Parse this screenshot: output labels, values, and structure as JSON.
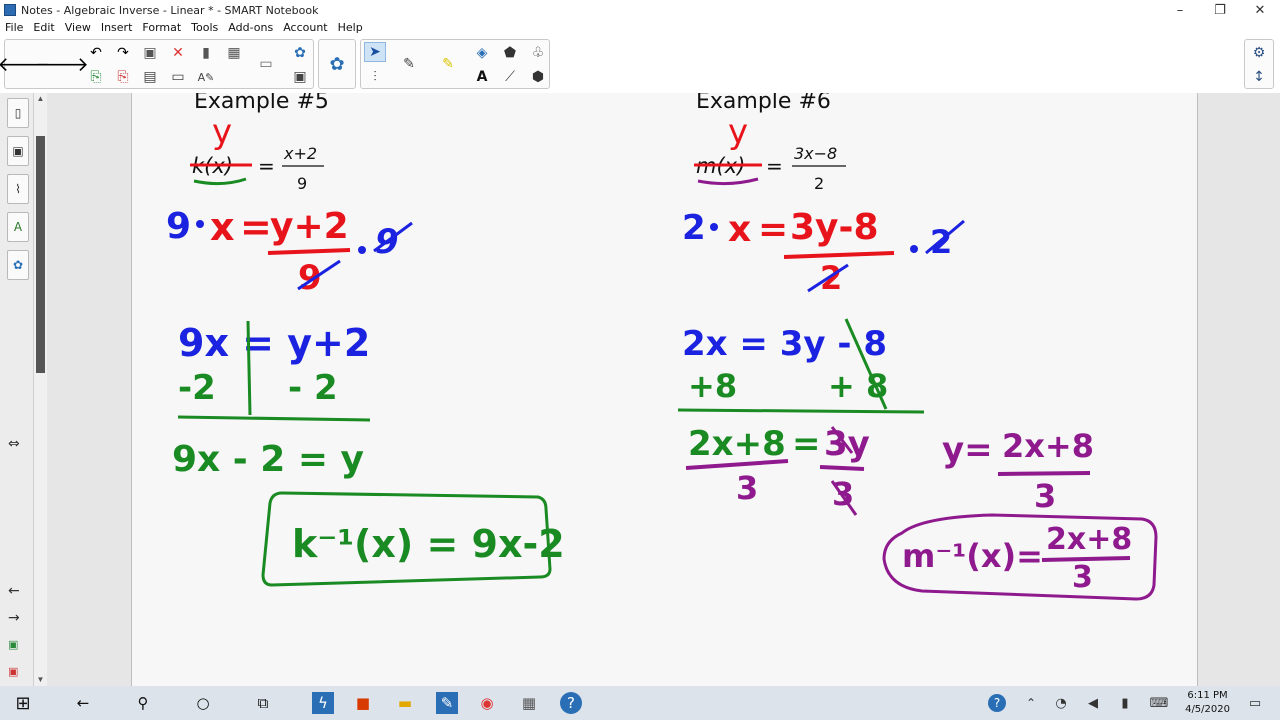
{
  "window": {
    "title": "Notes - Algebraic Inverse - Linear * - SMART Notebook",
    "controls": {
      "minimize": "–",
      "restore": "❐",
      "close": "✕"
    }
  },
  "menu": [
    "File",
    "Edit",
    "View",
    "Insert",
    "Format",
    "Tools",
    "Add-ons",
    "Account",
    "Help"
  ],
  "toolbar": {
    "icons": [
      "back-arrow-icon",
      "forward-arrow-icon",
      "undo-icon",
      "redo-icon",
      "add-page-icon",
      "delete-icon",
      "screen-shade-icon",
      "table-icon",
      "addons-icon",
      "save-icon",
      "paste-icon",
      "display-icon",
      "full-screen-icon",
      "spell-icon",
      "capture-icon",
      "screen-icon",
      "puzzle-icon",
      "select-icon",
      "pen-icon",
      "highlighter-icon",
      "shapes-icon",
      "fill-icon",
      "eraser-icon",
      "text-icon",
      "line-icon",
      "measure-icon",
      "gear-icon",
      "expand-icon"
    ],
    "text_tool_glyph": "A"
  },
  "side_tabs": [
    "page-sorter-icon",
    "gallery-icon",
    "attachments-icon",
    "properties-icon",
    "addons-icon"
  ],
  "page": {
    "example5": {
      "heading": "Example #5",
      "equation_lhs": "k(x)",
      "equation_sign": "=",
      "numerator": "x+2",
      "denominator": "9",
      "replacement_var": "y",
      "step1": {
        "mult": "9",
        "lhs": "x",
        "eq": "=",
        "numerator": "y+2",
        "denominator": "9",
        "mult_right": "9"
      },
      "step2_row1": "9x = y+2",
      "step2_row2_left": "-2",
      "step2_row2_right": "- 2",
      "step3": "9x - 2 = y",
      "answer": "k⁻¹(x) = 9x-2"
    },
    "example6": {
      "heading": "Example #6",
      "equation_lhs": "m(x)",
      "equation_sign": "=",
      "numerator": "3x−8",
      "denominator": "2",
      "replacement_var": "y",
      "step1": {
        "mult": "2",
        "lhs": "x",
        "eq": "=",
        "numerator": "3y-8",
        "denominator": "2",
        "mult_right": "2"
      },
      "step2_row1": "2x = 3y - 8",
      "step2_row2_left": "+8",
      "step2_row2_right": "+ 8",
      "step3_numerator": "2x+8",
      "step3_eq": "=",
      "step3_rhs": "3y",
      "step3_den_left": "3",
      "step3_den_right": "3",
      "side_y": "y=",
      "side_num": "2x+8",
      "side_den": "3",
      "answer_lhs": "m⁻¹(x)=",
      "answer_num": "2x+8",
      "answer_den": "3"
    },
    "colors": {
      "red": "#e8141c",
      "blue": "#1b22e0",
      "green": "#1a8a23",
      "purple": "#8e1a8e",
      "black": "#111111"
    }
  },
  "taskbar": {
    "icons": [
      "windows-start-icon",
      "back-icon",
      "search-icon",
      "cortana-icon",
      "task-view-icon",
      "smart-icon",
      "office-icon",
      "file-explorer-icon",
      "notebook-icon",
      "chrome-icon",
      "app-icon",
      "help-icon"
    ],
    "tray_icons": [
      "help-icon",
      "people-icon",
      "wifi-icon",
      "volume-icon",
      "battery-icon",
      "keyboard-icon",
      "notification-icon"
    ],
    "time": "6:11 PM",
    "date": "4/5/2020"
  }
}
